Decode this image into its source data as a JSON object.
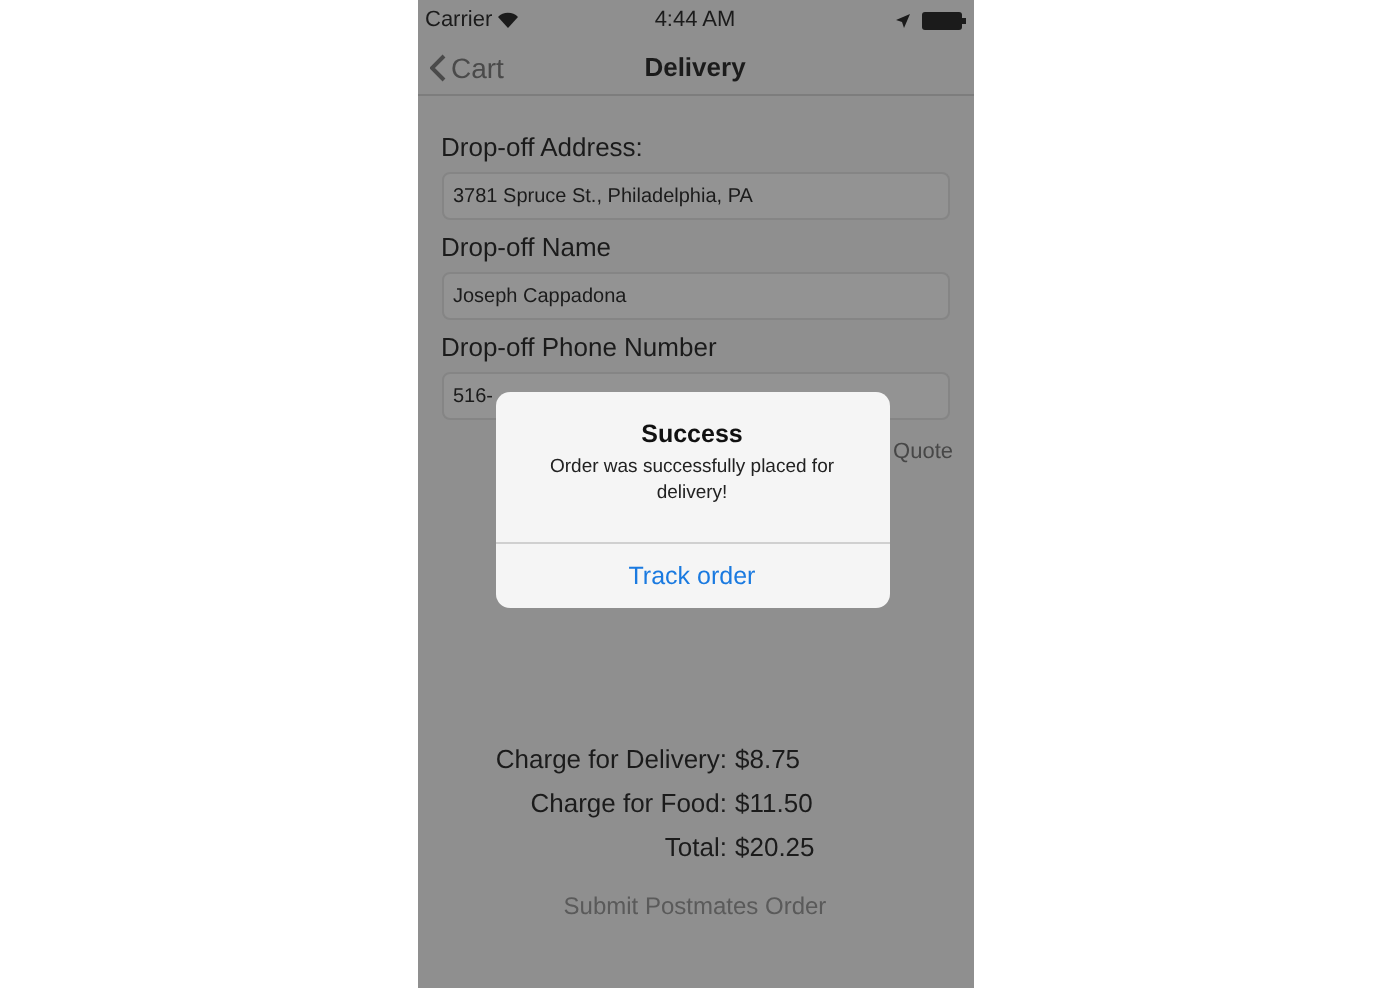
{
  "status_bar": {
    "carrier": "Carrier",
    "time": "4:44 AM"
  },
  "nav": {
    "back": "Cart",
    "title": "Delivery"
  },
  "fields": [
    {
      "label": "Drop-off Address:",
      "value": "3781 Spruce St., Philadelphia, PA"
    },
    {
      "label": "Drop-off Name",
      "value": "Joseph Cappadona"
    },
    {
      "label": "Drop-off Phone Number",
      "value": "516-"
    }
  ],
  "quote_button": "Quote",
  "charges": [
    {
      "label": "Charge for Delivery:",
      "amount": "$8.75"
    },
    {
      "label": "Charge for Food:",
      "amount": "$11.50"
    },
    {
      "label": "Total:",
      "amount": "$20.25"
    }
  ],
  "submit_button": "Submit Postmates Order",
  "alert": {
    "title": "Success",
    "message": "Order was successfully placed for delivery!",
    "action": "Track order"
  }
}
